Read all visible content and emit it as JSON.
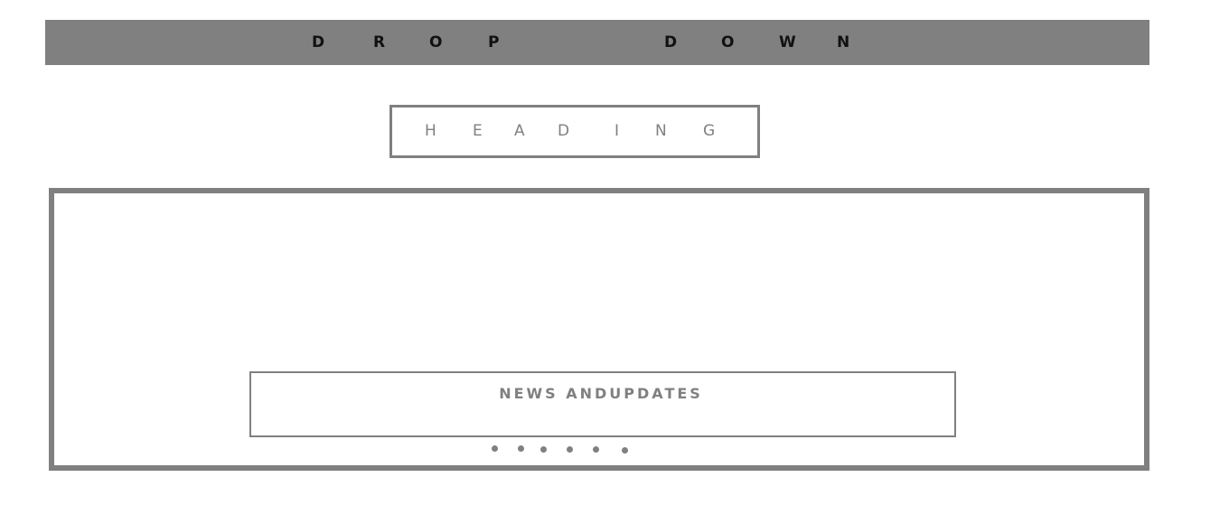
{
  "dropdown": {
    "letters": [
      "D",
      "R",
      "O",
      "P",
      "D",
      "O",
      "W",
      "N"
    ]
  },
  "heading": {
    "letters": [
      "H",
      "E",
      "A",
      "D",
      "I",
      "N",
      "G"
    ]
  },
  "slider": {
    "news_label": "NEWS ANDUPDATES",
    "dot_count": 6
  },
  "colors": {
    "bar_gray": "#808080",
    "text_dark": "#111111"
  }
}
